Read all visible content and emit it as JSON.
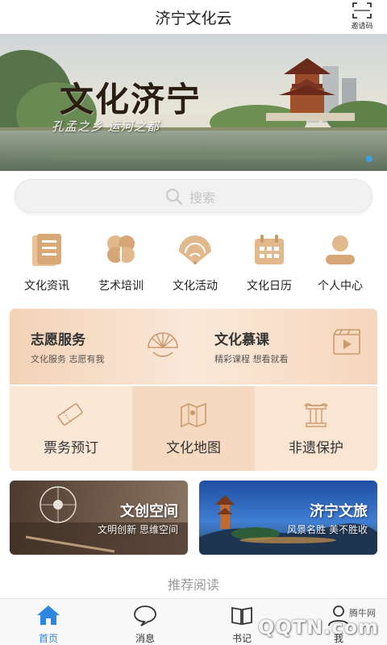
{
  "header": {
    "title": "济宁文化云",
    "invite_label": "邀请码"
  },
  "banner": {
    "title": "文化济宁",
    "subtitle": "孔孟之乡 运河之都"
  },
  "search": {
    "placeholder": "搜索"
  },
  "quick_menu": [
    {
      "label": "文化资讯",
      "icon": "news-document-icon"
    },
    {
      "label": "艺术培训",
      "icon": "clover-icon"
    },
    {
      "label": "文化活动",
      "icon": "folding-fan-icon"
    },
    {
      "label": "文化日历",
      "icon": "calendar-icon"
    },
    {
      "label": "个人中心",
      "icon": "user-icon"
    }
  ],
  "feature_cards": [
    {
      "title": "志愿服务",
      "subtitle": "文化服务 志愿有我",
      "icon": "seashell-fan-icon"
    },
    {
      "title": "文化慕课",
      "subtitle": "精彩课程 想看就看",
      "icon": "video-clapper-icon"
    }
  ],
  "service_cards": [
    {
      "label": "票务预订",
      "icon": "ticket-icon"
    },
    {
      "label": "文化地图",
      "icon": "map-pin-icon"
    },
    {
      "label": "非遗保护",
      "icon": "column-pillar-icon"
    }
  ],
  "promos": [
    {
      "title": "文创空间",
      "subtitle": "文明创新 思维空间"
    },
    {
      "title": "济宁文旅",
      "subtitle": "风景名胜 美不胜收"
    }
  ],
  "recommend_heading": "推荐阅读",
  "tabbar": [
    {
      "label": "首页",
      "icon": "home-icon",
      "active": true
    },
    {
      "label": "消息",
      "icon": "chat-bubble-icon",
      "active": false
    },
    {
      "label": "书记",
      "icon": "book-icon",
      "active": false
    },
    {
      "label": "我",
      "icon": "profile-icon",
      "active": false
    }
  ],
  "watermark": {
    "top": "腾牛网",
    "text": "QQTN.com"
  },
  "colors": {
    "accent_blue": "#2f86e0",
    "icon_tan": "#e2b98d",
    "card_peach": "#f7e1cf"
  }
}
